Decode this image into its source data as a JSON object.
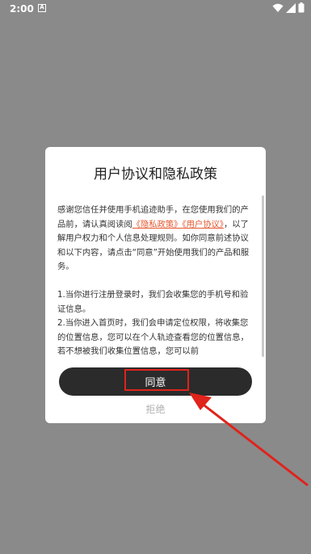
{
  "status_bar": {
    "time": "2:00",
    "notification_letter": "A"
  },
  "dialog": {
    "title": "用户协议和隐私政策",
    "intro_1": "感谢您信任并使用手机追迹助手，在您使用我们的产品前，请认真阅读阅",
    "link_privacy": "《隐私政策》",
    "link_user": "《用户协议》",
    "intro_2": "，以了解用户权力和个人信息处理规则。如你同意前述协议和以下内容，请点击“同意”开始使用我们的产品和服务。",
    "item_1": "1.当你进行注册登录时，我们会收集您的手机号和验证信息。",
    "item_2": "2.当你进入首页时，我们会申请定位权限，将收集您的位置信息，您可以在个人轨迹查看您的位置信息，若不想被我们收集位置信息，您可以前",
    "agree_label": "同意",
    "reject_label": "拒绝"
  },
  "colors": {
    "overlay": "#8a8a8a",
    "link": "#e5562f",
    "button": "#2b2b2b",
    "annotation": "#e0231b"
  }
}
